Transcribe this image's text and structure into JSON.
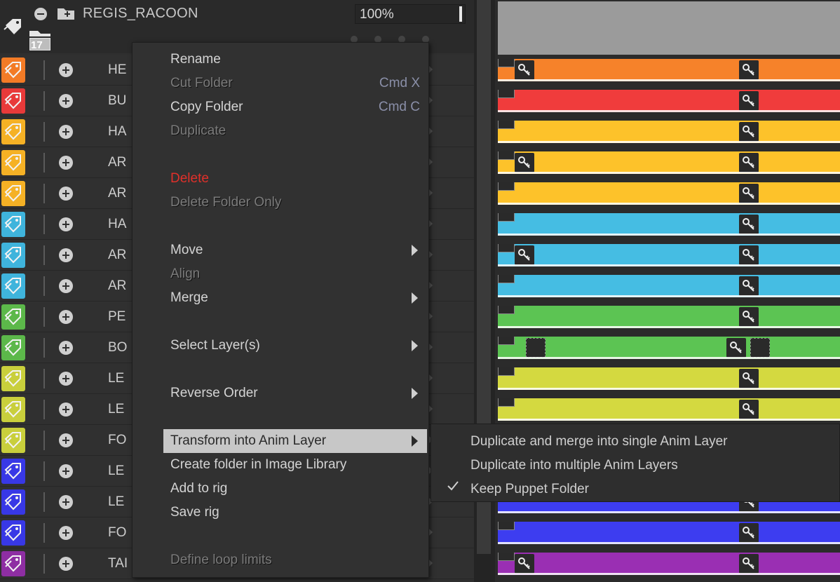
{
  "header": {
    "folder_name": "REGIS_RACOON",
    "opacity": "100%",
    "folder_count": "17"
  },
  "layers": [
    {
      "label": "HE",
      "color": "#f37b26"
    },
    {
      "label": "BU",
      "color": "#e83a3a"
    },
    {
      "label": "HA",
      "color": "#f5b125"
    },
    {
      "label": "AR",
      "color": "#f5b125"
    },
    {
      "label": "AR",
      "color": "#f5b125"
    },
    {
      "label": "HA",
      "color": "#3fb4dc"
    },
    {
      "label": "AR",
      "color": "#3fb4dc"
    },
    {
      "label": "AR",
      "color": "#3fb4dc"
    },
    {
      "label": "PE",
      "color": "#5cb84a"
    },
    {
      "label": "BO",
      "color": "#5cb84a"
    },
    {
      "label": "LE",
      "color": "#c9cf3c"
    },
    {
      "label": "LE",
      "color": "#c9cf3c"
    },
    {
      "label": "FO",
      "color": "#c9cf3c"
    },
    {
      "label": "LE",
      "color": "#3838e6"
    },
    {
      "label": "LE",
      "color": "#3838e6"
    },
    {
      "label": "FO",
      "color": "#3838e6"
    },
    {
      "label": "TAI",
      "color": "#8e2ea3"
    }
  ],
  "track_colors": [
    "#f6822a",
    "#f03c3c",
    "#fdc22a",
    "#fdc22a",
    "#fdc22a",
    "#45bde3",
    "#45bde3",
    "#45bde3",
    "#5cc453",
    "#5cc453",
    "#d4d940",
    "#d4d940",
    "#d4d940",
    "#3d3df0",
    "#3d3df0",
    "#3d3df0",
    "#9a2fb3"
  ],
  "context_menu": {
    "rename": "Rename",
    "cut_folder": "Cut Folder",
    "cut_shortcut": "Cmd X",
    "copy_folder": "Copy Folder",
    "copy_shortcut": "Cmd C",
    "duplicate": "Duplicate",
    "delete": "Delete",
    "delete_folder_only": "Delete Folder Only",
    "move": "Move",
    "align": "Align",
    "merge": "Merge",
    "select_layers": "Select Layer(s)",
    "reverse_order": "Reverse Order",
    "transform_anim": "Transform into Anim Layer",
    "create_folder_library": "Create folder in Image Library",
    "add_to_rig": "Add to rig",
    "save_rig": "Save rig",
    "define_loop_limits": "Define loop limits"
  },
  "submenu": {
    "dup_merge": "Duplicate and merge into single Anim Layer",
    "dup_multiple": "Duplicate into multiple Anim Layers",
    "keep_puppet": "Keep Puppet Folder"
  },
  "colors": {
    "accent_delete": "#e0302a",
    "highlight": "#c7c7c7"
  }
}
